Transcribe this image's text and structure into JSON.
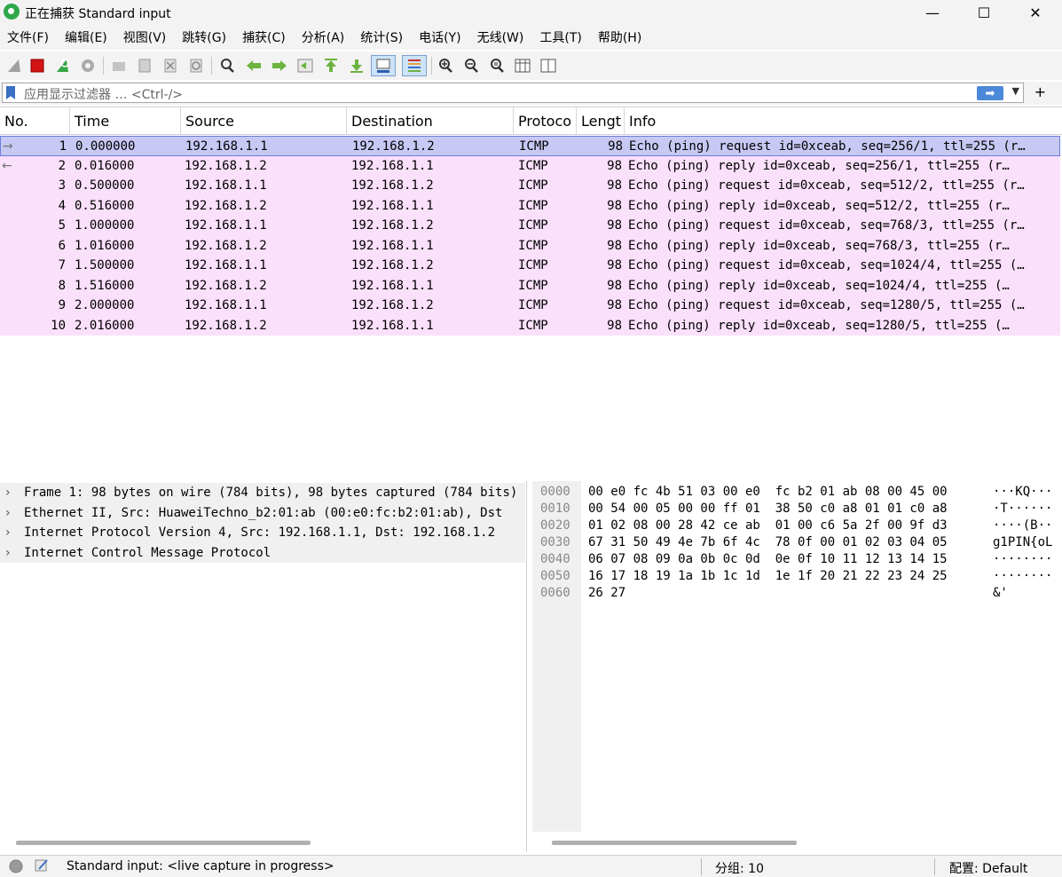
{
  "window": {
    "title": "正在捕获 Standard input",
    "minimize": "—",
    "maximize": "☐",
    "close": "✕"
  },
  "menu": [
    "文件(F)",
    "编辑(E)",
    "视图(V)",
    "跳转(G)",
    "捕获(C)",
    "分析(A)",
    "统计(S)",
    "电话(Y)",
    "无线(W)",
    "工具(T)",
    "帮助(H)"
  ],
  "filter": {
    "placeholder": "应用显示过滤器 … <Ctrl-/>",
    "apply_icon": "arrow-right-icon",
    "add": "+"
  },
  "columns": [
    "No.",
    "Time",
    "Source",
    "Destination",
    "Protoco",
    "Lengt",
    "Info"
  ],
  "packets": [
    {
      "no": "1",
      "time": "0.000000",
      "src": "192.168.1.1",
      "dst": "192.168.1.2",
      "proto": "ICMP",
      "len": "98",
      "info": "Echo (ping) request  id=0xceab, seq=256/1, ttl=255 (r…",
      "dir": "→"
    },
    {
      "no": "2",
      "time": "0.016000",
      "src": "192.168.1.2",
      "dst": "192.168.1.1",
      "proto": "ICMP",
      "len": "98",
      "info": "Echo (ping) reply    id=0xceab, seq=256/1, ttl=255 (r…",
      "dir": "←"
    },
    {
      "no": "3",
      "time": "0.500000",
      "src": "192.168.1.1",
      "dst": "192.168.1.2",
      "proto": "ICMP",
      "len": "98",
      "info": "Echo (ping) request  id=0xceab, seq=512/2, ttl=255 (r…",
      "dir": ""
    },
    {
      "no": "4",
      "time": "0.516000",
      "src": "192.168.1.2",
      "dst": "192.168.1.1",
      "proto": "ICMP",
      "len": "98",
      "info": "Echo (ping) reply    id=0xceab, seq=512/2, ttl=255 (r…",
      "dir": ""
    },
    {
      "no": "5",
      "time": "1.000000",
      "src": "192.168.1.1",
      "dst": "192.168.1.2",
      "proto": "ICMP",
      "len": "98",
      "info": "Echo (ping) request  id=0xceab, seq=768/3, ttl=255 (r…",
      "dir": ""
    },
    {
      "no": "6",
      "time": "1.016000",
      "src": "192.168.1.2",
      "dst": "192.168.1.1",
      "proto": "ICMP",
      "len": "98",
      "info": "Echo (ping) reply    id=0xceab, seq=768/3, ttl=255 (r…",
      "dir": ""
    },
    {
      "no": "7",
      "time": "1.500000",
      "src": "192.168.1.1",
      "dst": "192.168.1.2",
      "proto": "ICMP",
      "len": "98",
      "info": "Echo (ping) request  id=0xceab, seq=1024/4, ttl=255 (…",
      "dir": ""
    },
    {
      "no": "8",
      "time": "1.516000",
      "src": "192.168.1.2",
      "dst": "192.168.1.1",
      "proto": "ICMP",
      "len": "98",
      "info": "Echo (ping) reply    id=0xceab, seq=1024/4, ttl=255 (…",
      "dir": ""
    },
    {
      "no": "9",
      "time": "2.000000",
      "src": "192.168.1.1",
      "dst": "192.168.1.2",
      "proto": "ICMP",
      "len": "98",
      "info": "Echo (ping) request  id=0xceab, seq=1280/5, ttl=255 (…",
      "dir": ""
    },
    {
      "no": "10",
      "time": "2.016000",
      "src": "192.168.1.2",
      "dst": "192.168.1.1",
      "proto": "ICMP",
      "len": "98",
      "info": "Echo (ping) reply    id=0xceab, seq=1280/5, ttl=255 (…",
      "dir": ""
    }
  ],
  "details": [
    "Frame 1: 98 bytes on wire (784 bits), 98 bytes captured (784 bits)",
    "Ethernet II, Src: HuaweiTechno_b2:01:ab (00:e0:fc:b2:01:ab), Dst",
    "Internet Protocol Version 4, Src: 192.168.1.1, Dst: 192.168.1.2",
    "Internet Control Message Protocol"
  ],
  "detail_chevron": "›",
  "bytes": [
    {
      "off": "0000",
      "hex": "00 e0 fc 4b 51 03 00 e0  fc b2 01 ab 08 00 45 00",
      "ascii": "···KQ···"
    },
    {
      "off": "0010",
      "hex": "00 54 00 05 00 00 ff 01  38 50 c0 a8 01 01 c0 a8",
      "ascii": "·T······"
    },
    {
      "off": "0020",
      "hex": "01 02 08 00 28 42 ce ab  01 00 c6 5a 2f 00 9f d3",
      "ascii": "····(B··"
    },
    {
      "off": "0030",
      "hex": "67 31 50 49 4e 7b 6f 4c  78 0f 00 01 02 03 04 05",
      "ascii": "g1PIN{oL"
    },
    {
      "off": "0040",
      "hex": "06 07 08 09 0a 0b 0c 0d  0e 0f 10 11 12 13 14 15",
      "ascii": "········"
    },
    {
      "off": "0050",
      "hex": "16 17 18 19 1a 1b 1c 1d  1e 1f 20 21 22 23 24 25",
      "ascii": "········"
    },
    {
      "off": "0060",
      "hex": "26 27",
      "ascii": "&'"
    }
  ],
  "status": {
    "capture_text": "Standard input: <live capture in progress>",
    "packets": "分组: 10",
    "profile": "配置: Default"
  },
  "colors": {
    "row_bg": "#fae0fa",
    "selected_bg": "#c8c8f5",
    "accent": "#4c88d8"
  }
}
